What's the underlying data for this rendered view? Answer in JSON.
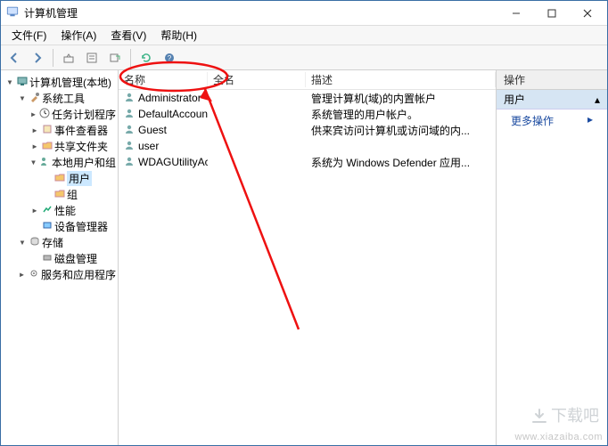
{
  "window": {
    "title": "计算机管理"
  },
  "menu": {
    "file": "文件(F)",
    "action": "操作(A)",
    "view": "查看(V)",
    "help": "帮助(H)"
  },
  "tree": {
    "root": "计算机管理(本地)",
    "sys_tools": "系统工具",
    "task_sched": "任务计划程序",
    "event_viewer": "事件查看器",
    "shared": "共享文件夹",
    "local_users": "本地用户和组",
    "users": "用户",
    "groups": "组",
    "perf": "性能",
    "dev_mgr": "设备管理器",
    "storage": "存储",
    "disk_mgr": "磁盘管理",
    "services_apps": "服务和应用程序"
  },
  "list": {
    "col_name": "名称",
    "col_full": "全名",
    "col_desc": "描述",
    "rows": [
      {
        "name": "Administrator",
        "full": "",
        "desc": "管理计算机(域)的内置帐户"
      },
      {
        "name": "DefaultAccount",
        "full": "",
        "desc": "系统管理的用户帐户。"
      },
      {
        "name": "Guest",
        "full": "",
        "desc": "供来宾访问计算机或访问域的内..."
      },
      {
        "name": "user",
        "full": "",
        "desc": ""
      },
      {
        "name": "WDAGUtilityAccount",
        "full": "",
        "desc": "系统为 Windows Defender 应用..."
      }
    ]
  },
  "actions": {
    "header": "操作",
    "group_label": "用户",
    "more": "更多操作"
  },
  "watermark": "www.xiazaiba.com",
  "dl_logo": "下载吧"
}
